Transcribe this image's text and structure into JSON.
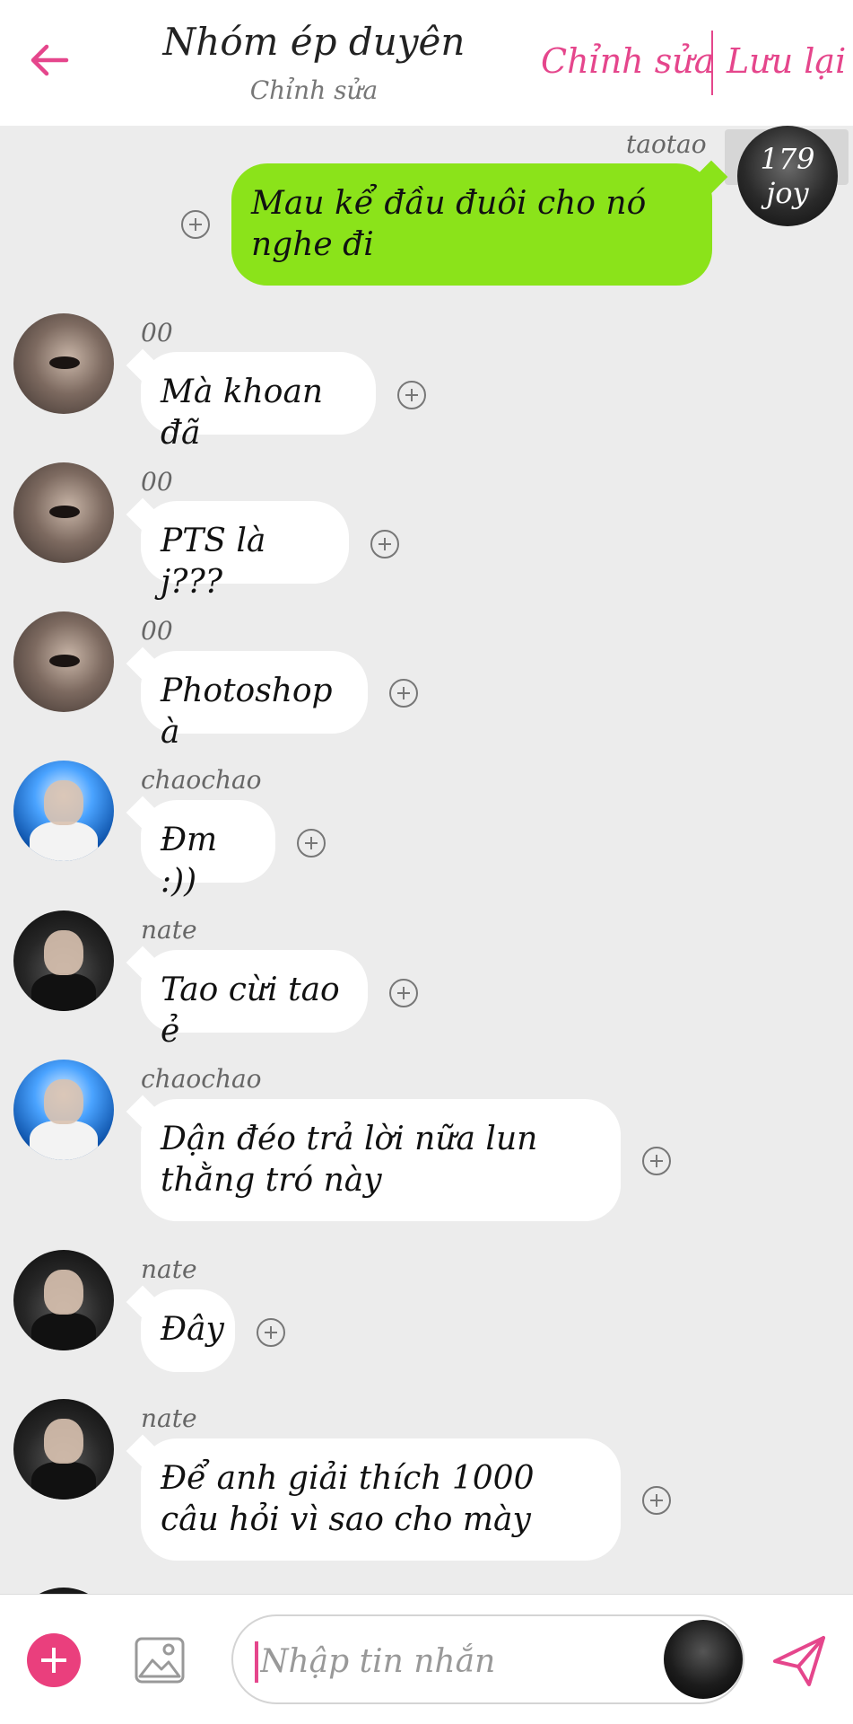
{
  "header": {
    "title": "Nhóm ép duyên",
    "subtitle": "Chỉnh sửa",
    "edit_label": "Chỉnh sửa",
    "save_label": "Lưu lại",
    "accent_color": "#e5468c"
  },
  "messages": [
    {
      "sender": "taotao",
      "text": "Mau kể đầu đuôi cho nó nghe đi",
      "mine": true,
      "avatar": "dark-avatar",
      "avatar_label": "179 joy"
    },
    {
      "sender": "00",
      "text": "Mà khoan đã",
      "avatar": "face-avatar"
    },
    {
      "sender": "00",
      "text": "PTS là j???",
      "avatar": "face-avatar"
    },
    {
      "sender": "00",
      "text": "Photoshop à",
      "avatar": "face-avatar"
    },
    {
      "sender": "chaochao",
      "text": "Đm :))",
      "avatar": "blue-avatar"
    },
    {
      "sender": "nate",
      "text": "Tao cừi tao ẻ",
      "avatar": "night-avatar"
    },
    {
      "sender": "chaochao",
      "text": "Dận đéo trả lời nữa lun thằng tró này",
      "avatar": "blue-avatar"
    },
    {
      "sender": "nate",
      "text": "Đây",
      "avatar": "night-avatar"
    },
    {
      "sender": "nate",
      "text": "Để anh giải thích 1000 câu hỏi vì sao cho mày",
      "avatar": "night-avatar"
    }
  ],
  "composer": {
    "placeholder": "Nhập tin nhắn",
    "plus_icon": "plus-circle-icon",
    "image_icon": "image-icon",
    "send_icon": "send-icon"
  },
  "colors": {
    "my_bubble": "#8be31a",
    "other_bubble": "#ffffff",
    "background": "#ececec"
  }
}
